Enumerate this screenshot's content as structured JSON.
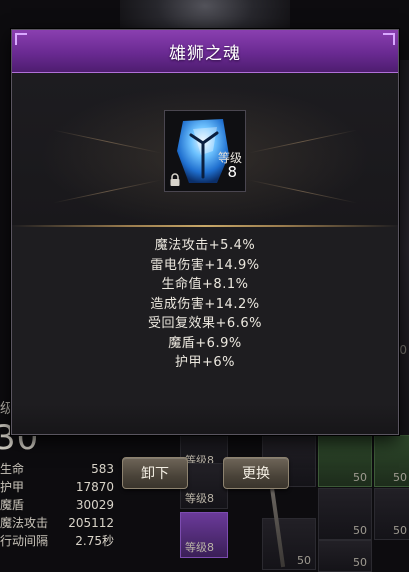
{
  "modal": {
    "title": "雄狮之魂",
    "item": {
      "icon": "rune-shard-icon",
      "level_label": "等级",
      "level": "8",
      "locked": true
    },
    "attributes": [
      "魔法攻击+5.4%",
      "雷电伤害+14.9%",
      "生命值+8.1%",
      "造成伤害+14.2%",
      "受回复效果+6.6%",
      "魔盾+6.9%",
      "护甲+6%"
    ]
  },
  "buttons": {
    "unequip": "卸下",
    "replace": "更换"
  },
  "background": {
    "level_label": "级",
    "level_value": "30",
    "side_values": [
      "50",
      "50"
    ],
    "stats": [
      {
        "label": "生命",
        "value": "583"
      },
      {
        "label": "护甲",
        "value": "17870"
      },
      {
        "label": "魔盾",
        "value": "30029"
      },
      {
        "label": "魔法攻击",
        "value": "205112"
      },
      {
        "label": "行动间隔",
        "value": "2.75秒"
      }
    ],
    "slot_labels": [
      "等级8",
      "等级8",
      "等级8"
    ],
    "slot_numbers": [
      "50",
      "50",
      "50",
      "50",
      "50",
      "50"
    ]
  },
  "colors": {
    "header_purple": "#6a2a92",
    "modal_bg": "#1e1d20",
    "item_glow": "#3fa8ff",
    "divider_gold": "#c8a868"
  }
}
